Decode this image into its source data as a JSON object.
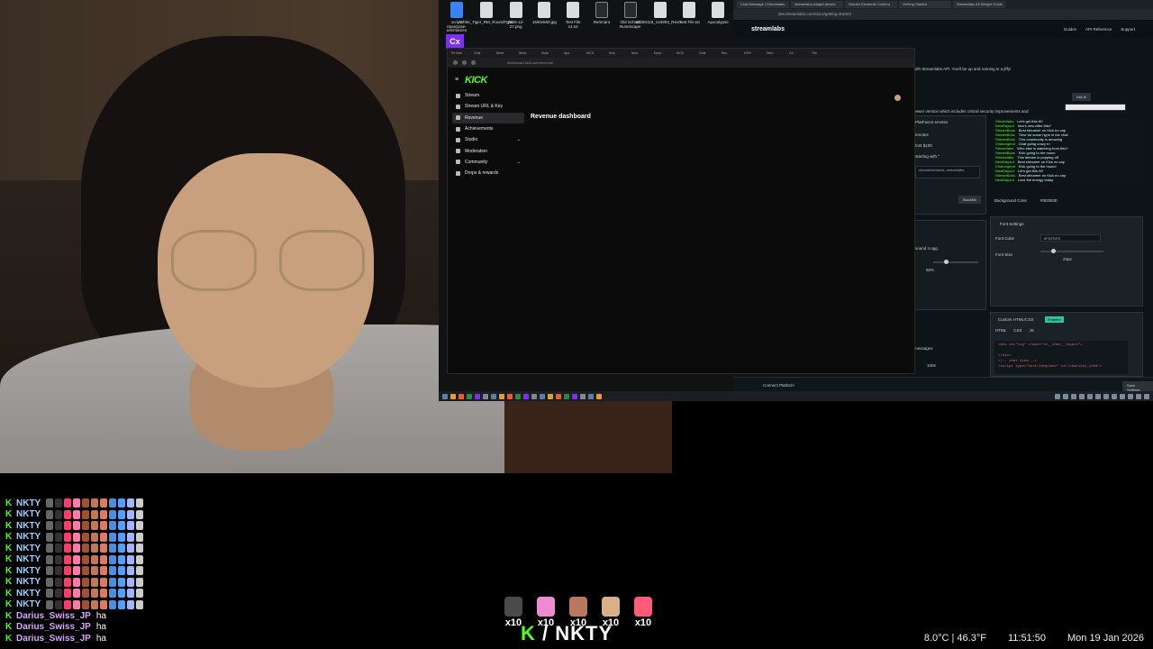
{
  "desktop_icons": [
    {
      "label": "script:\nrepurpose-usernames",
      "icon": "file-icon"
    },
    {
      "label": "White_Tiger_RM_RoundType",
      "icon": "font-file-icon"
    },
    {
      "label": "2025-12-27.png",
      "icon": "image-icon"
    },
    {
      "label": "1500x500.jpg",
      "icon": "image-icon"
    },
    {
      "label": "Test File n1.txt",
      "icon": "text-file-icon"
    },
    {
      "label": "Remnant",
      "icon": "game-icon"
    },
    {
      "label": "Old School RuneScape",
      "icon": "game-icon"
    },
    {
      "label": "20260119_143903_Revo...",
      "icon": "file-icon"
    },
    {
      "label": "Test File.txt",
      "icon": "text-file-icon"
    },
    {
      "label": "Apocalypse",
      "icon": "app-icon"
    }
  ],
  "cx_icon": "Cx",
  "streamlabs": {
    "tabs": [
      "Chat Message | Streamlabs",
      "streamlabs-widget-develo",
      "Stream Elements Content",
      "Getting Started",
      "Streamlabs All Widget Guide"
    ],
    "url": "dev.streamlabs.com/docs/getting-started",
    "brand": "streamlabs",
    "nav": [
      "Guides",
      "API Reference",
      "Support"
    ],
    "intro": "with Streamlabs API. You'll be up and running in a jiffy!",
    "ask_ai": "Ask AI",
    "version_note": "newer version which includes critical security improvements and",
    "chat_lines": [
      {
        "name": "Streamlabs",
        "msg": "Let's get this W!"
      },
      {
        "name": "NewDayout",
        "msg": "how's new after this?"
      },
      {
        "name": "StreamBoss",
        "msg": "Best streamer on Kick no cap"
      },
      {
        "name": "StreamBoss",
        "msg": "Time for some hype in the chat"
      },
      {
        "name": "StreamBoss",
        "msg": "This community is amazing"
      },
      {
        "name": "ChatLegend",
        "msg": "Chat going crazy rn"
      },
      {
        "name": "Streamlabs",
        "msg": "Who else is watching from this?"
      },
      {
        "name": "StreamBoss",
        "msg": "Kick going to the moon"
      },
      {
        "name": "Streamlabs",
        "msg": "This stream is popping off"
      },
      {
        "name": "NewDayout",
        "msg": "Best streamer on Kick no cap"
      },
      {
        "name": "ChatLegend",
        "msg": "Kick going to the moon!"
      },
      {
        "name": "NewDayout",
        "msg": "Let's get this W!"
      },
      {
        "name": "StreamBoss",
        "msg": "Best streamer on Kick no cap"
      },
      {
        "name": "NewDayout",
        "msg": "Love the energy today"
      }
    ],
    "labels": {
      "emotes": "PlatFace2 emotes",
      "emotes_sub": "emotes",
      "font_100": "font $100",
      "starting_with": "starting with \"",
      "streamelements": "streamelements, streamlabs",
      "blacklist": "Blacklist",
      "bg_color": "Background Color",
      "bg_value": "#0E0E0E",
      "font_settings": "Font Settings",
      "font_color": "Font Color",
      "font_color_value": "#FDFDFD",
      "font_size": "Font Size",
      "font_size_value": "22px",
      "sound_file": "sound 4.ogg",
      "volume": "50%",
      "custom_html": "Custom HTML/CSS",
      "enabled": "Enabled",
      "code_tabs": [
        "HTML",
        "CSS",
        "JS"
      ],
      "messages": "messages",
      "duration": "100s",
      "connect": "Connect Platform",
      "save": "Save Settings"
    },
    "code_lines": [
      "<div id=\"log\" class=\"sl__chat__layout\">",
      "",
      "</div>",
      "<!-- chat item -->",
      "<script type=\"text/template\" id=\"chatlist_item\">"
    ]
  },
  "kick": {
    "url": "dashboard.kick.com/revenue",
    "logo": "KICK",
    "page_title": "Revenue dashboard",
    "sidebar": [
      {
        "label": "Stream",
        "icon": "stream-icon",
        "chevron": false
      },
      {
        "label": "Stream URL & Key",
        "icon": "key-icon",
        "chevron": false
      },
      {
        "label": "Revenue",
        "icon": "revenue-icon",
        "chevron": false,
        "active": true
      },
      {
        "label": "Achievements",
        "icon": "trophy-icon",
        "chevron": false
      },
      {
        "label": "Studio",
        "icon": "studio-icon",
        "chevron": true
      },
      {
        "label": "Moderation",
        "icon": "wrench-icon",
        "chevron": false
      },
      {
        "label": "Community",
        "icon": "community-icon",
        "chevron": true
      },
      {
        "label": "Drops & rewards",
        "icon": "gift-icon",
        "chevron": false
      }
    ],
    "tabs": [
      "P6 Kick",
      "Chat",
      "Stree",
      "Strea",
      "Scrip",
      "Apo",
      "KICK",
      "Kick",
      "Mon",
      "Dono",
      "KICK",
      "Chat",
      "Rev",
      "HTM",
      "Dem",
      "C#",
      "The"
    ]
  },
  "overlay_chat": [
    {
      "name": "NKTY",
      "emotes": 11
    },
    {
      "name": "NKTY",
      "emotes": 11
    },
    {
      "name": "NKTY",
      "emotes": 11
    },
    {
      "name": "NKTY",
      "emotes": 11
    },
    {
      "name": "NKTY",
      "emotes": 11
    },
    {
      "name": "NKTY",
      "emotes": 11
    },
    {
      "name": "NKTY",
      "emotes": 11
    },
    {
      "name": "NKTY",
      "emotes": 11
    },
    {
      "name": "NKTY",
      "emotes": 11
    },
    {
      "name": "NKTY",
      "emotes": 11
    },
    {
      "name": "Darius_Swiss_JP",
      "msg": "ha"
    },
    {
      "name": "Darius_Swiss_JP",
      "msg": "ha"
    },
    {
      "name": "Darius_Swiss_JP",
      "msg": "ha"
    }
  ],
  "gifts": [
    {
      "count": "x10",
      "color": "#4a4a4a"
    },
    {
      "count": "x10",
      "color": "#f08ad0"
    },
    {
      "count": "x10",
      "color": "#b7795a"
    },
    {
      "count": "x10",
      "color": "#d8b08c"
    },
    {
      "count": "x10",
      "color": "#ff5a78"
    }
  ],
  "brand_line": {
    "k": "K",
    "rest": " / NKTY"
  },
  "status": {
    "weather": "8.0°C | 46.3°F",
    "time": "11:51:50",
    "date": "Mon 19 Jan 2026"
  },
  "colors": {
    "kick_green": "#53fc18",
    "streamlabs_teal": "#31c3a2"
  }
}
